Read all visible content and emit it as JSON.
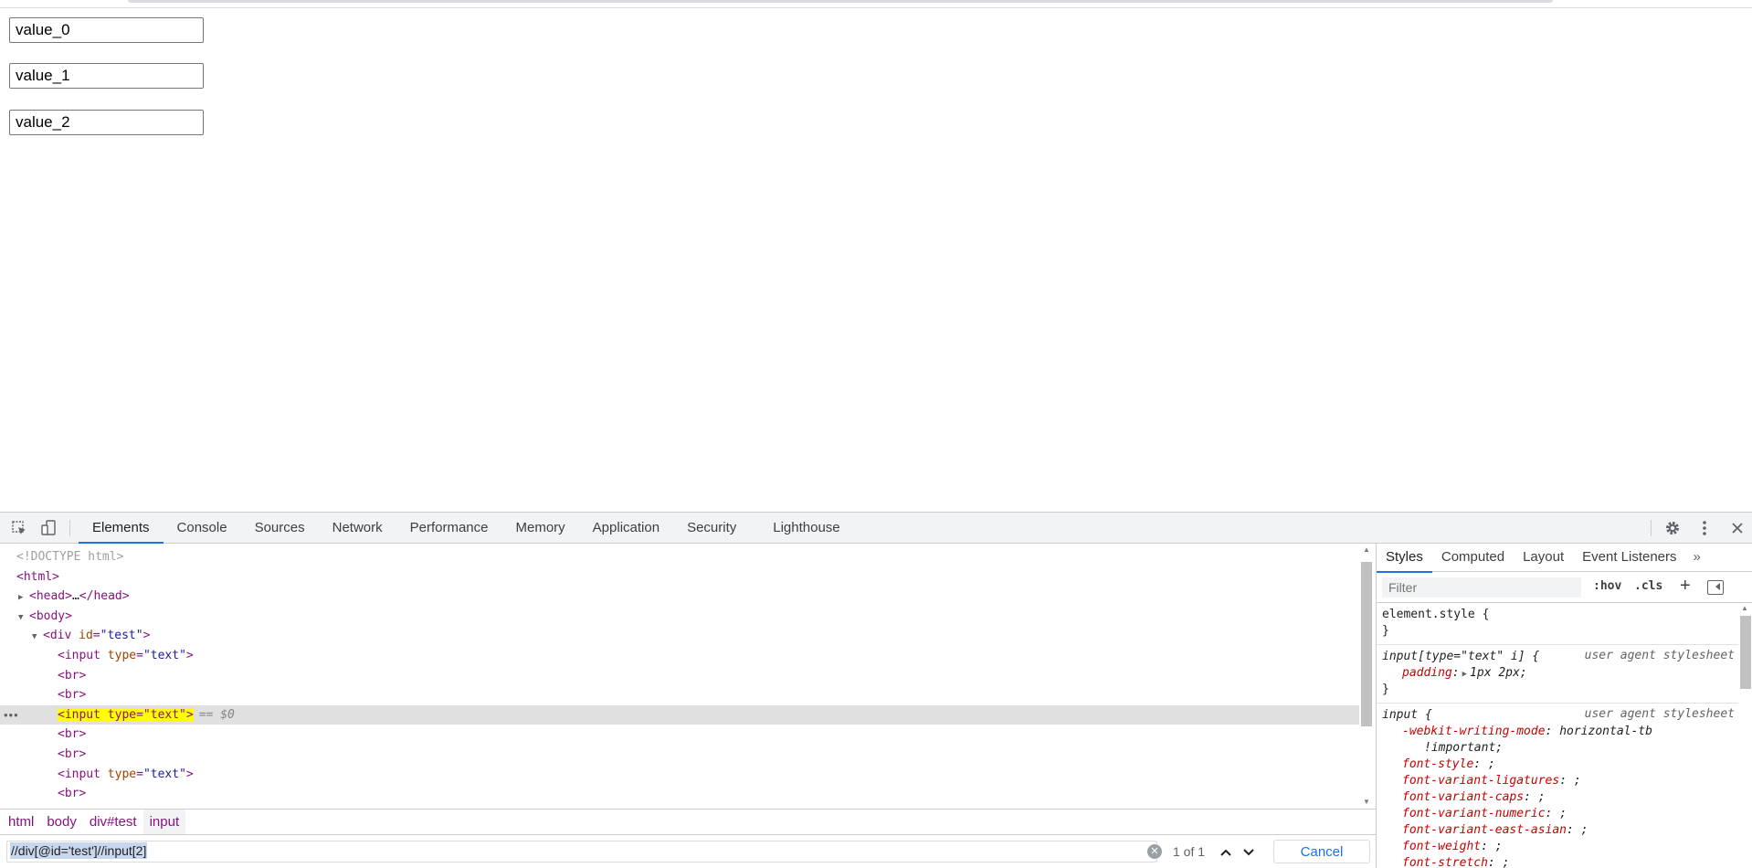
{
  "page": {
    "inputs": [
      {
        "value": "value_0"
      },
      {
        "value": "value_1"
      },
      {
        "value": "value_2"
      }
    ]
  },
  "devtools": {
    "tabs": [
      "Elements",
      "Console",
      "Sources",
      "Network",
      "Performance",
      "Memory",
      "Application",
      "Security",
      "Lighthouse"
    ],
    "active_tab": "Elements",
    "tree": {
      "doctype": "<!DOCTYPE html>",
      "html_open": "<html>",
      "head_open": "<head>",
      "head_ellipsis": "…",
      "head_close": "</head>",
      "body_open": "<body>",
      "div_tag": "<div",
      "div_attr_name": "id",
      "div_attr_eq": "=",
      "div_attr_value": "\"test\"",
      "tag_close": ">",
      "input_tag": "<input",
      "input_attr_name": "type",
      "input_attr_eq": "=",
      "input_attr_value": "\"text\"",
      "br": "<br>",
      "selected_input": "<input type=\"text\">",
      "dollar_ref": "== $0",
      "row_dots": "•••"
    },
    "breadcrumb": [
      "html",
      "body",
      "div#test",
      "input"
    ],
    "search": {
      "query": "//div[@id='test']//input[2]",
      "match_count": "1 of 1",
      "cancel_label": "Cancel"
    },
    "sidebar": {
      "tabs": [
        "Styles",
        "Computed",
        "Layout",
        "Event Listeners"
      ],
      "active_tab": "Styles",
      "more_icon": "»",
      "filter_placeholder": "Filter",
      "hov_label": ":hov",
      "cls_label": ".cls",
      "plus_label": "+",
      "rules": {
        "element_style": {
          "selector": "element.style {",
          "close": "}"
        },
        "ua_input_text": {
          "selector": "input[type=\"text\" i] {",
          "origin": "user agent stylesheet",
          "prop_name": "padding",
          "prop_value": "1px 2px;",
          "close": "}"
        },
        "ua_input": {
          "selector": "input {",
          "origin": "user agent stylesheet",
          "props": [
            {
              "name": "-webkit-writing-mode",
              "value": "horizontal-tb",
              "cont": "!important;"
            },
            {
              "name": "font-style",
              "value": ";"
            },
            {
              "name": "font-variant-ligatures",
              "value": ";"
            },
            {
              "name": "font-variant-caps",
              "value": ";"
            },
            {
              "name": "font-variant-numeric",
              "value": ";"
            },
            {
              "name": "font-variant-east-asian",
              "value": ";"
            },
            {
              "name": "font-weight",
              "value": ";"
            },
            {
              "name": "font-stretch",
              "value": ";"
            }
          ]
        }
      }
    }
  }
}
